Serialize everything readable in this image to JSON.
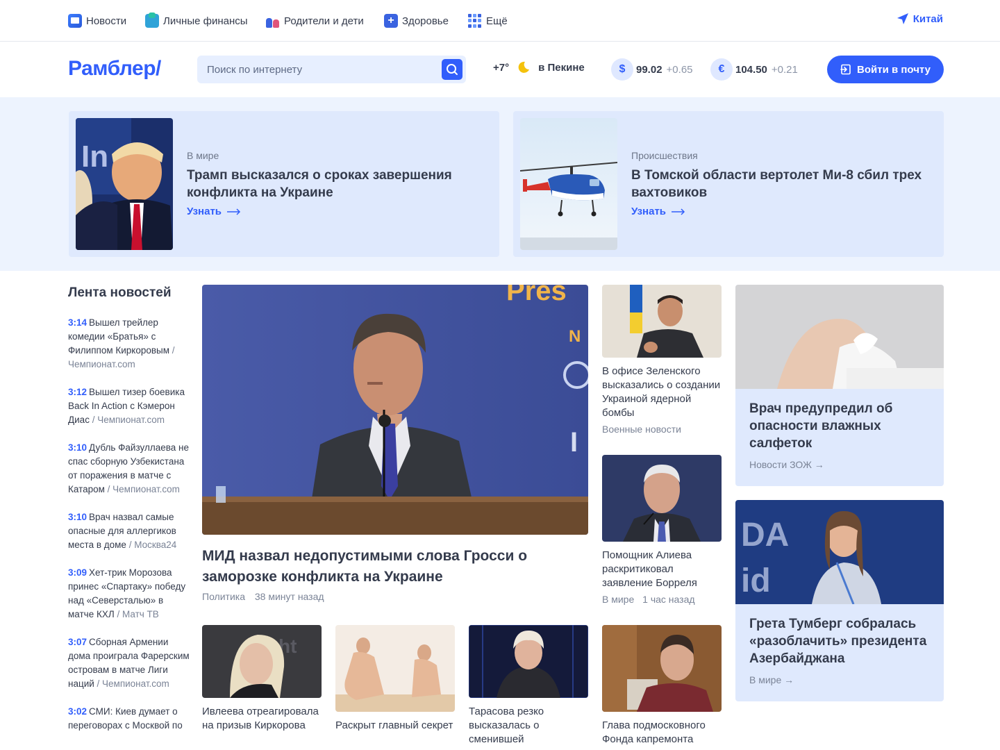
{
  "topnav": {
    "items": [
      {
        "label": "Новости",
        "icon": "news-icon"
      },
      {
        "label": "Личные финансы",
        "icon": "finance-icon"
      },
      {
        "label": "Родители и дети",
        "icon": "family-icon"
      },
      {
        "label": "Здоровье",
        "icon": "health-icon"
      },
      {
        "label": "Ещё",
        "icon": "grid-icon"
      }
    ],
    "region": "Китай"
  },
  "header": {
    "logo": "Рамблер/",
    "search_placeholder": "Поиск по интернету",
    "weather_temp": "+7°",
    "weather_city": "в Пекине",
    "usd_symbol": "$",
    "usd_value": "99.02",
    "usd_change": "+0.65",
    "eur_symbol": "€",
    "eur_value": "104.50",
    "eur_change": "+0.21",
    "login_label": "Войти в почту"
  },
  "promos": [
    {
      "category": "В мире",
      "title": "Трамп высказался о сроках завершения конфликта на Украине",
      "more": "Узнать"
    },
    {
      "category": "Происшествия",
      "title": "В Томской области вертолет Ми-8 сбил трех вахтовиков",
      "more": "Узнать"
    }
  ],
  "feed": {
    "title": "Лента новостей",
    "items": [
      {
        "time": "3:14",
        "text": "Вышел трейлер комедии «Братья» с Филиппом Киркоровым",
        "source": " / Чемпионат.com"
      },
      {
        "time": "3:12",
        "text": "Вышел тизер боевика Back In Action с Кэмерон Диас",
        "source": " / Чемпионат.com"
      },
      {
        "time": "3:10",
        "text": "Дубль Файзуллаева не спас сборную Узбекистана от поражения в матче с Катаром",
        "source": " / Чемпионат.com"
      },
      {
        "time": "3:10",
        "text": "Врач назвал самые опасные для аллергиков места в доме",
        "source": " / Москва24"
      },
      {
        "time": "3:09",
        "text": "Хет-трик Морозова принес «Спартаку» победу над «Северсталью» в матче КХЛ",
        "source": " / Матч ТВ"
      },
      {
        "time": "3:07",
        "text": "Сборная Армении дома проиграла Фарерским островам в матче Лиги наций",
        "source": " / Чемпионат.com"
      },
      {
        "time": "3:02",
        "text": "СМИ: Киев думает о переговорах с Москвой по",
        "source": ""
      }
    ]
  },
  "main": {
    "title": "МИД назвал недопустимыми слова Гросси о заморозке конфликта на Украине",
    "category": "Политика",
    "time": "38 минут назад"
  },
  "side_cards": [
    {
      "title": "В офисе Зеленского высказались о создании Украиной ядерной бомбы",
      "category": "Военные новости",
      "time": ""
    },
    {
      "title": "Помощник Алиева раскритиковал заявление Борреля",
      "category": "В мире",
      "time": "1 час назад"
    }
  ],
  "bottom_cards": [
    {
      "title": "Ивлеева отреагировала на призыв Киркорова"
    },
    {
      "title": "Раскрыт главный секрет"
    },
    {
      "title": "Тарасова резко высказалась о сменившей"
    },
    {
      "title": "Глава подмосковного Фонда капремонта"
    }
  ],
  "right_cards": [
    {
      "title": "Врач предупредил об опасности влажных салфеток",
      "source": "Новости ЗОЖ →"
    },
    {
      "title": "Грета Тумберг собралась «разоблачить» президента Азербайджана",
      "source": "В мире →"
    }
  ],
  "colors": {
    "accent": "#315efb",
    "band": "#edf3fe",
    "card": "#dfe9fd",
    "text": "#343b4c",
    "muted": "#7a8396"
  }
}
